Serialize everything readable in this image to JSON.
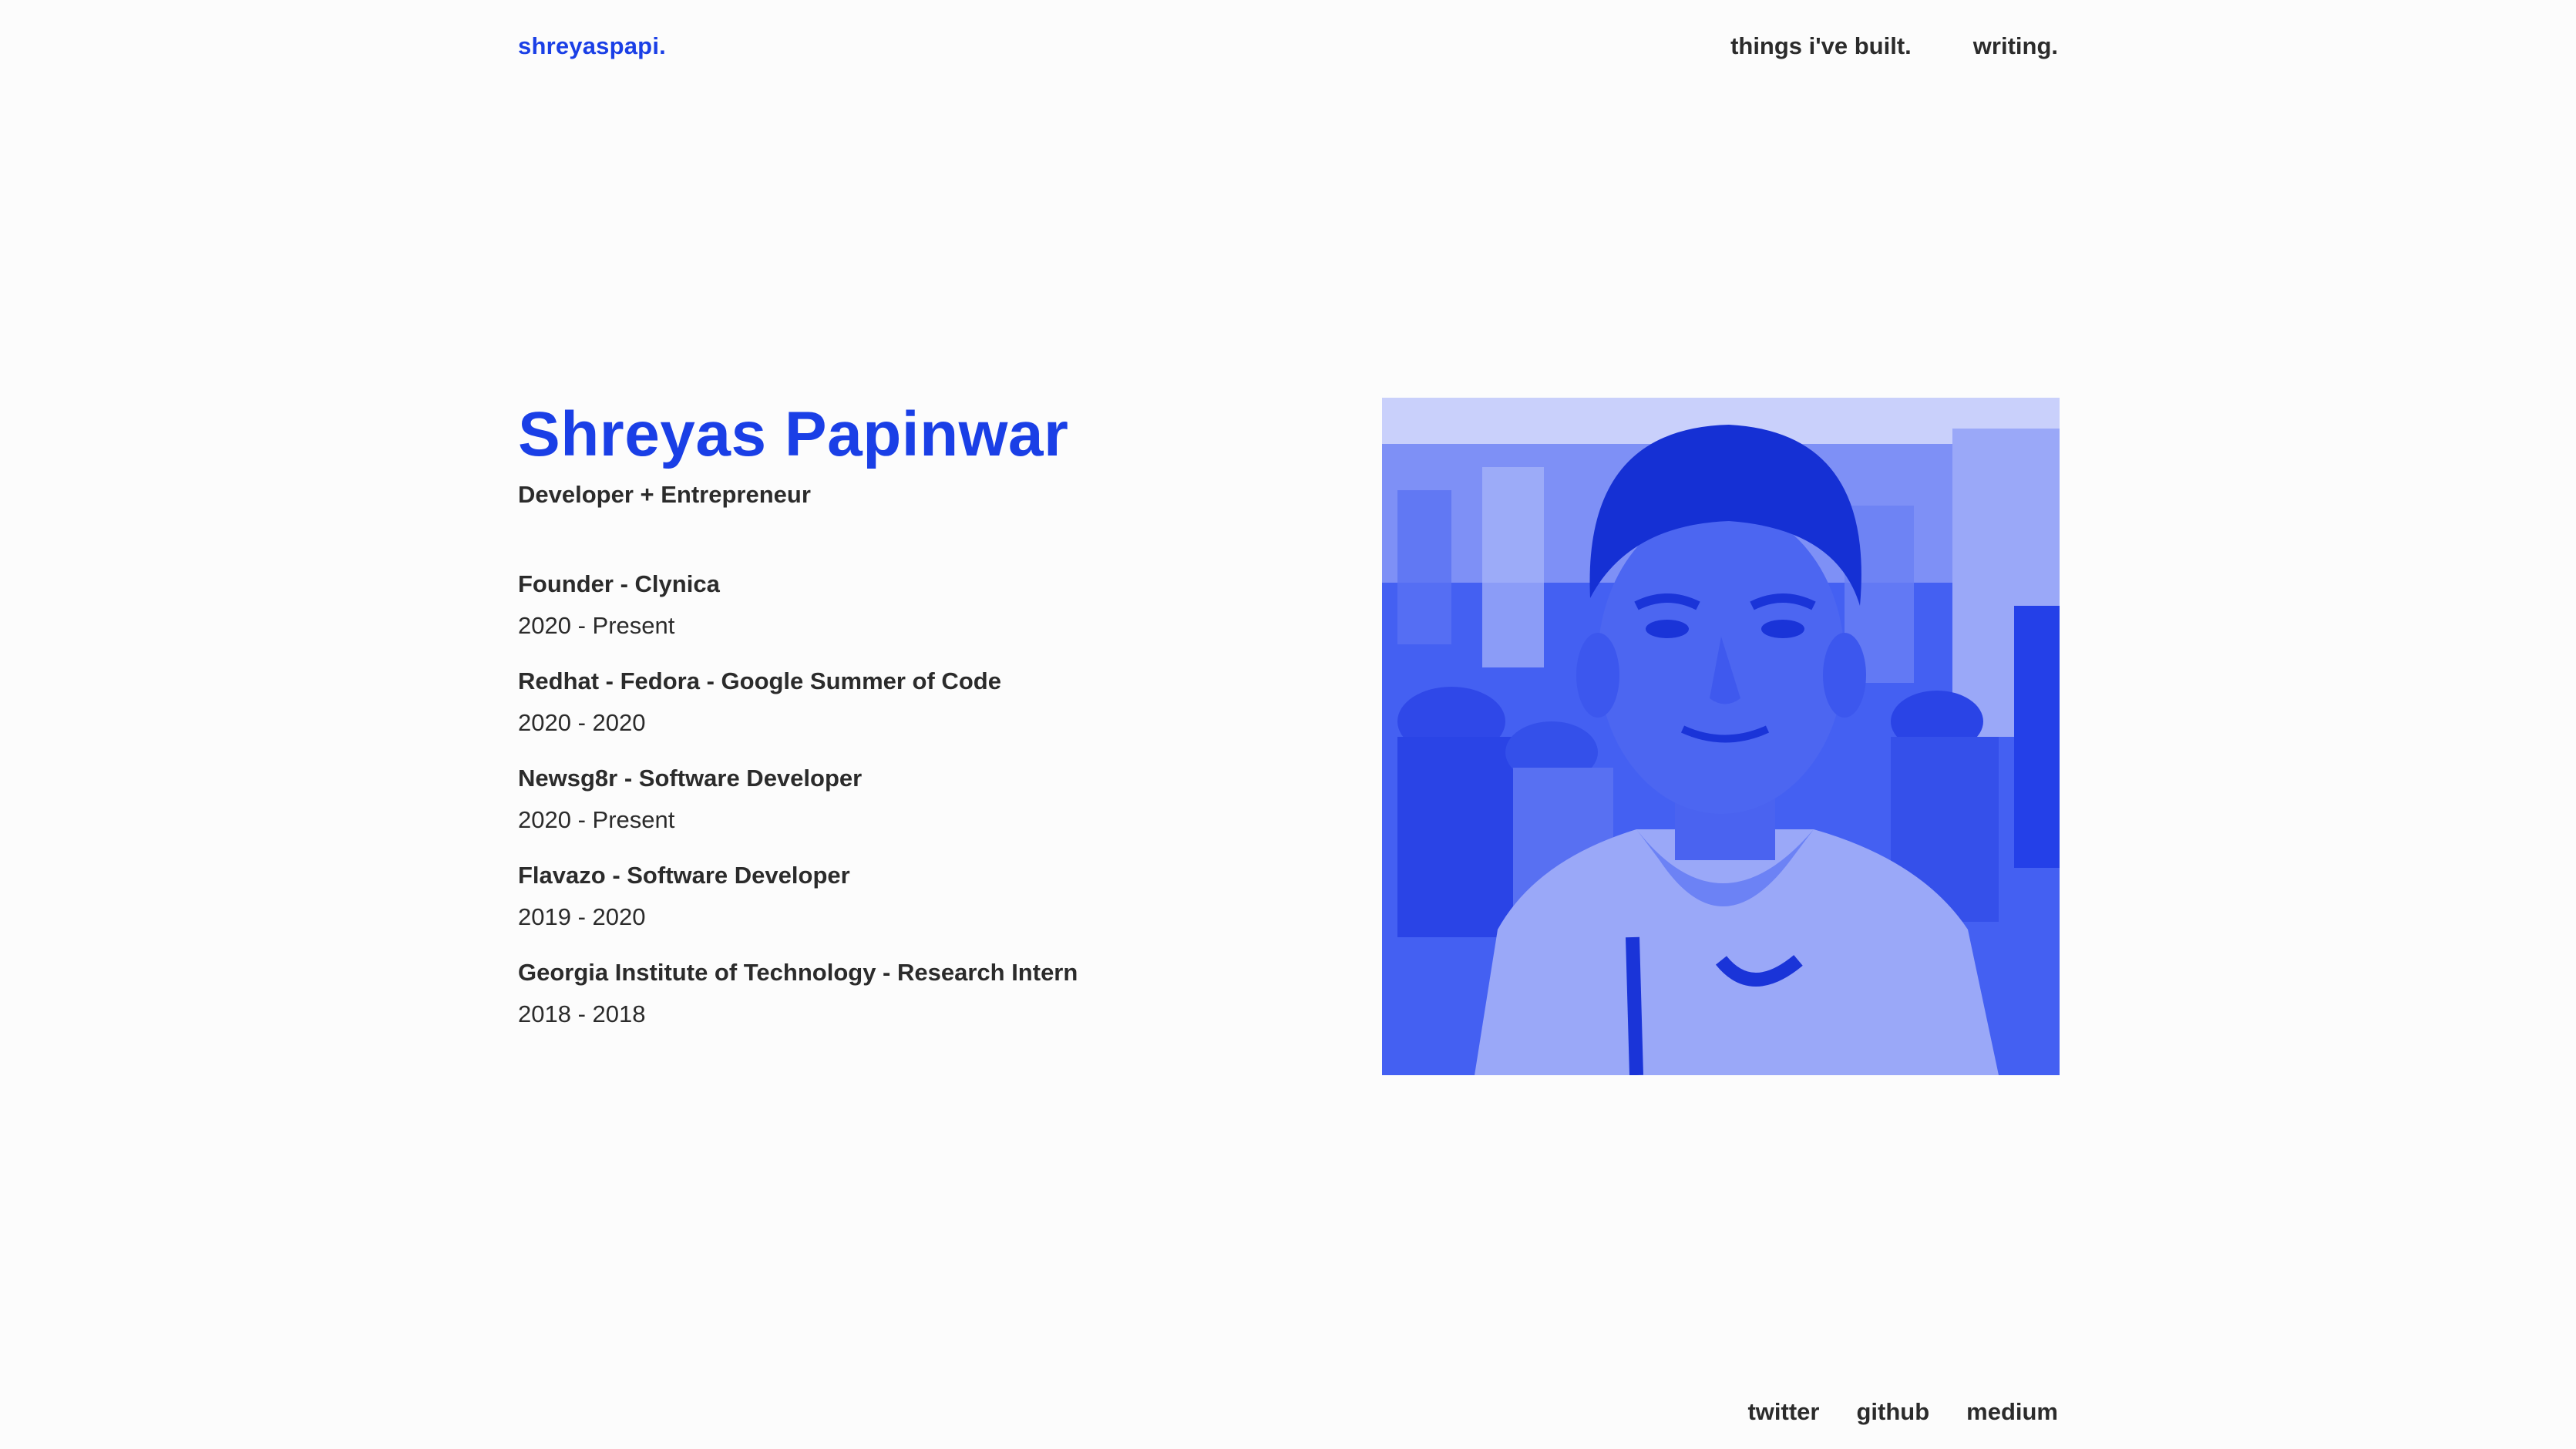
{
  "header": {
    "brand": "shreyaspapi.",
    "nav": [
      {
        "label": "things i've built."
      },
      {
        "label": "writing."
      }
    ]
  },
  "hero": {
    "name": "Shreyas Papinwar",
    "tagline": "Developer + Entrepreneur",
    "experience": [
      {
        "title": "Founder - Clynica",
        "dates": "2020 - Present"
      },
      {
        "title": "Redhat - Fedora - Google Summer of Code",
        "dates": "2020 - 2020"
      },
      {
        "title": "Newsg8r - Software Developer",
        "dates": "2020 - Present"
      },
      {
        "title": "Flavazo - Software Developer",
        "dates": "2019 - 2020"
      },
      {
        "title": "Georgia Institute of Technology - Research Intern",
        "dates": "2018 - 2018"
      }
    ]
  },
  "portrait": {
    "icon": "portrait-photo"
  },
  "footer": {
    "links": [
      {
        "label": "twitter"
      },
      {
        "label": "github"
      },
      {
        "label": "medium"
      }
    ]
  },
  "colors": {
    "accent": "#1a3fe6",
    "text": "#2b2b2b",
    "background": "#fcfcfc",
    "photo_tint": "#3a56f0"
  }
}
